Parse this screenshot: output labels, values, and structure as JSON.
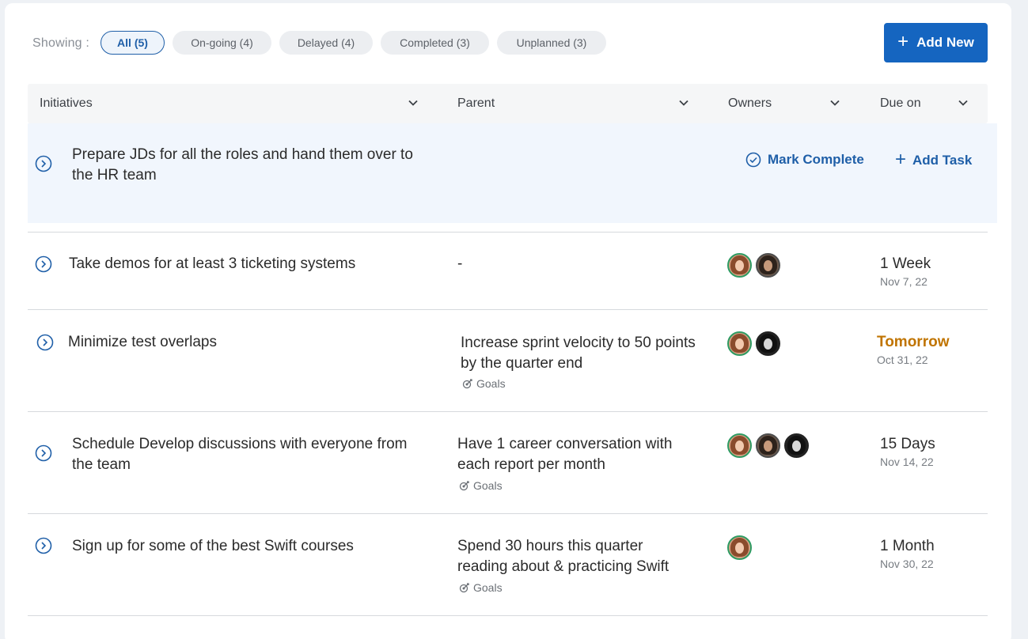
{
  "filters": {
    "label": "Showing :",
    "chips": [
      {
        "label": "All (5)",
        "active": true
      },
      {
        "label": "On-going (4)",
        "active": false
      },
      {
        "label": "Delayed (4)",
        "active": false
      },
      {
        "label": "Completed (3)",
        "active": false
      },
      {
        "label": "Unplanned (3)",
        "active": false
      }
    ]
  },
  "toolbar": {
    "add_new_label": "Add New"
  },
  "columns": {
    "initiatives": "Initiatives",
    "parent": "Parent",
    "owners": "Owners",
    "due_on": "Due on"
  },
  "row_actions": {
    "mark_complete": "Mark Complete",
    "add_task": "Add Task"
  },
  "rows": [
    {
      "title_line1": "Prepare JDs for all the roles and hand them over to",
      "title_line2": "the HR team",
      "parent": "",
      "owners": [],
      "due": "",
      "due_date": ""
    },
    {
      "title_line1": "Take demos for at least 3 ticketing systems",
      "parent": "-",
      "owners": [
        "avatar-1",
        "avatar-2"
      ],
      "due": "1 Week",
      "due_date": "Nov 7, 22"
    },
    {
      "title_line1": "Minimize test overlaps",
      "parent_line1": "Increase sprint velocity to 50 points",
      "parent_line2": "by the quarter end",
      "parent_tag": "Goals",
      "owners": [
        "avatar-1",
        "avatar-3"
      ],
      "due": "Tomorrow",
      "due_date": "Oct 31, 22",
      "due_color": "#c07400"
    },
    {
      "title_line1": "Schedule Develop discussions with everyone from",
      "title_line2": "the team",
      "parent_line1": "Have 1 career conversation with",
      "parent_line2": "each report per month",
      "parent_tag": "Goals",
      "owners": [
        "avatar-1",
        "avatar-2",
        "avatar-3"
      ],
      "due": "15 Days",
      "due_date": "Nov 14, 22"
    },
    {
      "title_line1": "Sign up for some of the best Swift courses",
      "parent_line1": "Spend 30 hours this quarter",
      "parent_line2": "reading about & practicing Swift",
      "parent_tag": "Goals",
      "owners": [
        "avatar-1"
      ],
      "due": "1 Month",
      "due_date": "Nov 30, 22"
    }
  ],
  "colors": {
    "accent": "#1565c0",
    "link": "#1f5fa8",
    "warning": "#c07400",
    "row_highlight": "#f1f6fd"
  },
  "icons": {
    "expander": "chevron-right-circle-icon",
    "sort": "chevron-down-icon",
    "mark_complete": "check-circle-icon",
    "add": "plus-icon",
    "goal": "target-icon"
  }
}
